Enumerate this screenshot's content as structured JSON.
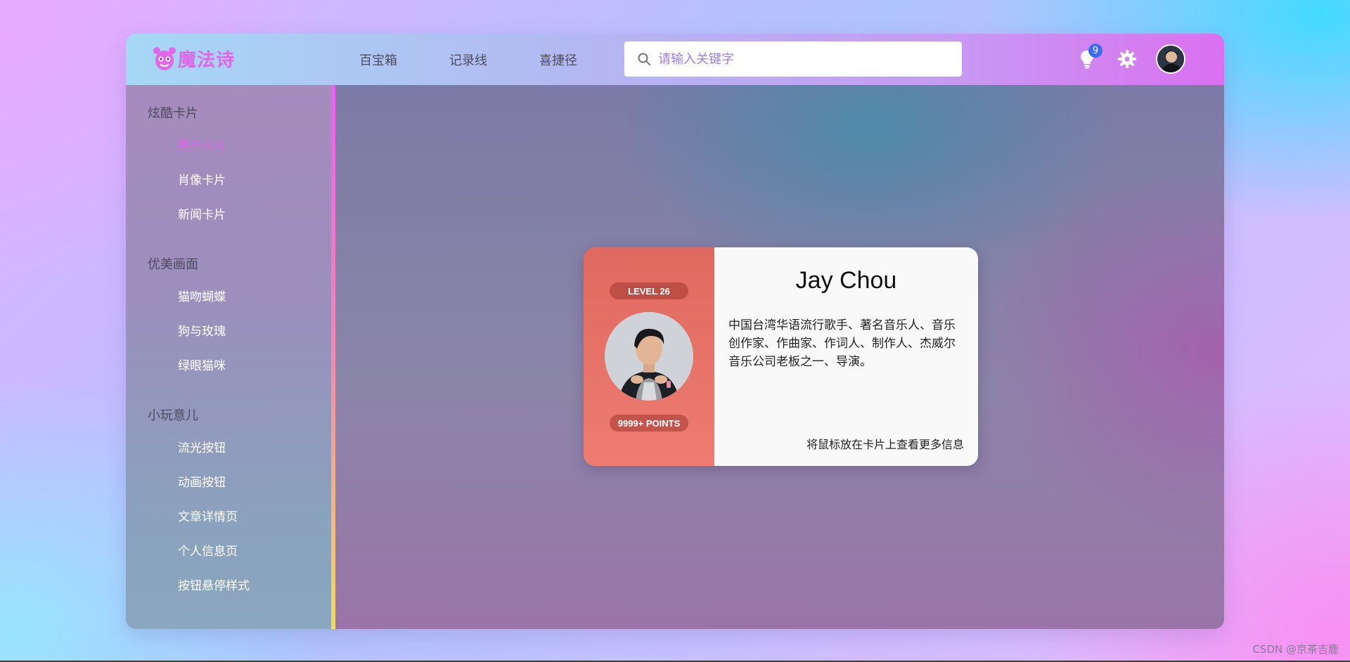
{
  "brand": {
    "name": "魔法诗",
    "color": "#e166e8"
  },
  "topnav": [
    "百宝箱",
    "记录线",
    "喜捷径"
  ],
  "search": {
    "placeholder": "请输入关键字",
    "value": ""
  },
  "header_icons": {
    "notification_count": "9"
  },
  "sidebar": {
    "groups": [
      {
        "title": "炫酷卡片",
        "items": [
          "用户卡片",
          "肖像卡片",
          "新闻卡片"
        ]
      },
      {
        "title": "优美画面",
        "items": [
          "猫吻蝴蝶",
          "狗与玫瑰",
          "绿眼猫咪"
        ]
      },
      {
        "title": "小玩意儿",
        "items": [
          "流光按钮",
          "动画按钮",
          "文章详情页",
          "个人信息页",
          "按钮悬停样式"
        ]
      }
    ],
    "active_item": "用户卡片",
    "active_color": "#e45ef0"
  },
  "card": {
    "level": "LEVEL 26",
    "points": "9999+ POINTS",
    "name": "Jay Chou",
    "description": "中国台湾华语流行歌手、著名音乐人、音乐创作家、作曲家、作词人、制作人、杰威尔音乐公司老板之一、导演。",
    "hint": "将鼠标放在卡片上查看更多信息",
    "accent": "#df6a5f"
  },
  "watermark": "CSDN @京茶吉鹿"
}
